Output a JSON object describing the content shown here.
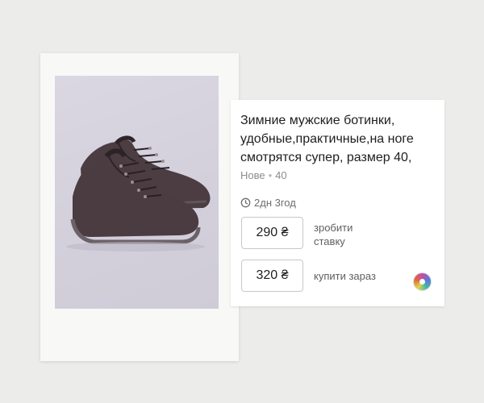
{
  "listing": {
    "title": "Зимние мужские ботинки,\nудобные,практичные,на ноге\nсмотрятся супер, размер 40,",
    "condition": "Нове",
    "size": "40",
    "time_left": "2дн 3год",
    "bid": {
      "price": "290 ₴",
      "label": "зробити\nставку"
    },
    "buy": {
      "price": "320 ₴",
      "label": "купити зараз"
    }
  },
  "icons": {
    "clock": "clock-icon",
    "avatar": "seller-avatar"
  },
  "colors": {
    "background": "#ececea",
    "card": "#ffffff",
    "text": "#1e1e1e",
    "muted": "#8c8c8c",
    "shoe": "#4a3c40"
  }
}
